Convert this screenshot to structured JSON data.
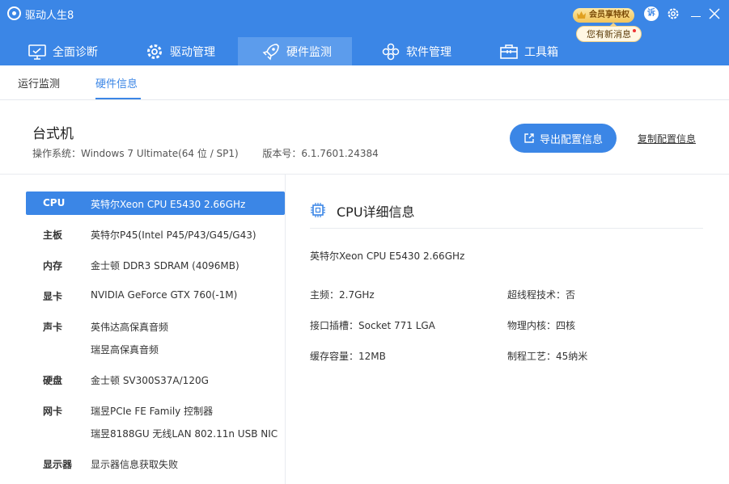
{
  "app": {
    "title": "驱动人生8"
  },
  "header": {
    "vip_badge": "会员享特权",
    "message_bubble": "您有新消息",
    "user_icon_text": "诉"
  },
  "nav": [
    {
      "label": "全面诊断",
      "icon": "monitor-check-icon"
    },
    {
      "label": "驱动管理",
      "icon": "gear-icon"
    },
    {
      "label": "硬件监测",
      "icon": "rocket-icon"
    },
    {
      "label": "软件管理",
      "icon": "flower-icon"
    },
    {
      "label": "工具箱",
      "icon": "toolbox-icon"
    }
  ],
  "subtabs": [
    {
      "label": "运行监测"
    },
    {
      "label": "硬件信息"
    }
  ],
  "summary": {
    "pc_type": "台式机",
    "os_label": "操作系统：Windows 7 Ultimate(64 位 / SP1)",
    "version_label": "版本号：6.1.7601.24384",
    "export_button": "导出配置信息",
    "copy_link": "复制配置信息"
  },
  "hardware": [
    {
      "label": "CPU",
      "values": [
        "英特尔Xeon CPU E5430 2.66GHz"
      ]
    },
    {
      "label": "主板",
      "values": [
        "英特尔P45(Intel P45/P43/G45/G43)"
      ]
    },
    {
      "label": "内存",
      "values": [
        "金士顿 DDR3 SDRAM (4096MB)"
      ]
    },
    {
      "label": "显卡",
      "values": [
        "NVIDIA GeForce GTX 760(-1M)"
      ]
    },
    {
      "label": "声卡",
      "values": [
        "英伟达高保真音频",
        "瑞昱高保真音频"
      ]
    },
    {
      "label": "硬盘",
      "values": [
        "金士顿 SV300S37A/120G"
      ]
    },
    {
      "label": "网卡",
      "values": [
        "瑞昱PCIe FE Family 控制器",
        "瑞昱8188GU 无线LAN 802.11n USB NIC"
      ]
    },
    {
      "label": "显示器",
      "values": [
        "显示器信息获取失败"
      ]
    }
  ],
  "detail": {
    "title": "CPU详细信息",
    "name": "英特尔Xeon CPU E5430 2.66GHz",
    "fields": {
      "freq": "主频：2.7GHz",
      "hyperthreading": "超线程技术：否",
      "socket": "接口插槽：Socket 771 LGA",
      "cores": "物理内核：四核",
      "cache": "缓存容量：12MB",
      "process": "制程工艺：45纳米"
    }
  },
  "colors": {
    "brand_blue": "#3b86e6",
    "active_nav": "#5c9cec"
  }
}
